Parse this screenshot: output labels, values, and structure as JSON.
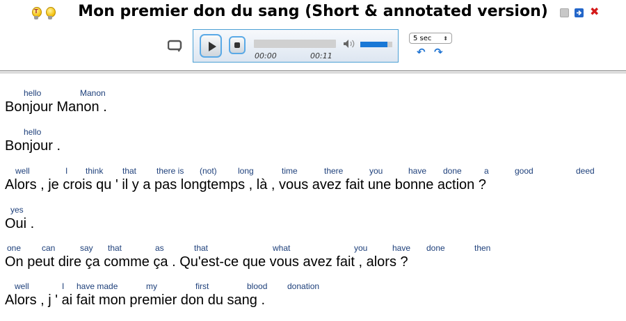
{
  "title": "Mon premier don du sang (Short & annotated version)",
  "icons": {
    "bulb_left_mark": "T",
    "bulb_right_mark": "",
    "window_buttons": [
      "minimize-icon",
      "forward-icon",
      "close-icon"
    ],
    "close_glyph": "✖"
  },
  "player": {
    "current_time": "00:00",
    "duration": "00:11",
    "progress": 0,
    "volume": 0.85,
    "skip_select": "5 sec",
    "skip_arrows": "◆"
  },
  "transcript": [
    {
      "glosses": [
        "hello",
        "Manon"
      ],
      "text": "Bonjour Manon ."
    },
    {
      "glosses": [
        "hello"
      ],
      "text": "Bonjour ."
    },
    {
      "glosses": [
        "well",
        "I",
        "think",
        "that",
        "there is",
        "(not)",
        "long",
        "time",
        "there",
        "you",
        "have",
        "done",
        "a",
        "good",
        "deed"
      ],
      "text": "Alors , je crois qu ' il y a pas longtemps , là , vous avez fait une bonne action ?"
    },
    {
      "glosses": [
        "yes"
      ],
      "text": "Oui ."
    },
    {
      "glosses": [
        "one",
        "can",
        "say",
        "that",
        "as",
        "that",
        "what",
        "you",
        "have",
        "done",
        "then"
      ],
      "text": "On peut dire ça comme ça . Qu'est-ce que vous avez fait , alors ?"
    },
    {
      "glosses": [
        "well",
        "I",
        "have made",
        "my",
        "first",
        "blood",
        "donation"
      ],
      "text": "Alors , j ' ai  fait mon premier don du sang ."
    }
  ]
}
